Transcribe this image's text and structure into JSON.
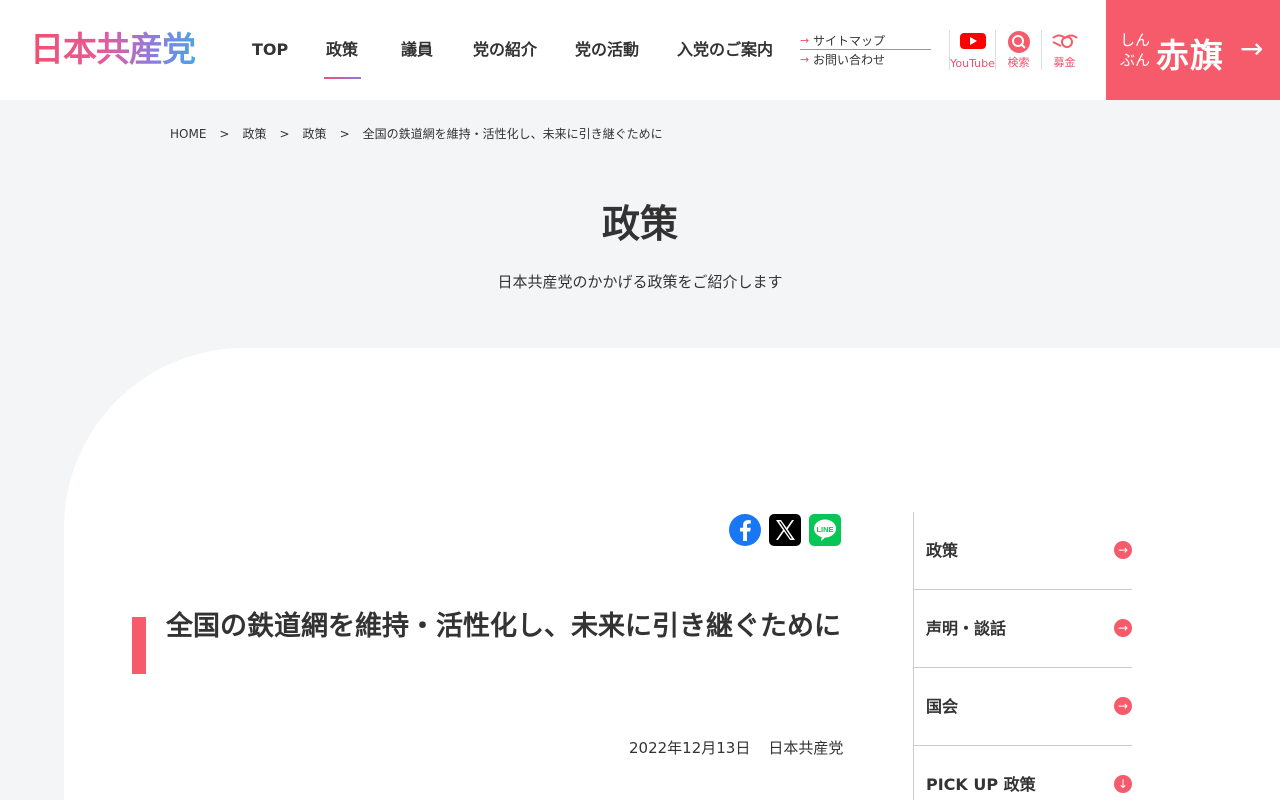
{
  "header": {
    "logo": "日本共産党",
    "nav": [
      "TOP",
      "政策",
      "議員",
      "党の紹介",
      "党の活動",
      "入党のご案内"
    ],
    "active_nav": "政策",
    "sublinks": [
      "サイトマップ",
      "お問い合わせ"
    ],
    "icons": [
      {
        "label": "YouTube",
        "icon": "youtube-icon"
      },
      {
        "label": "検索",
        "icon": "search-icon"
      },
      {
        "label": "募金",
        "icon": "donation-icon"
      }
    ],
    "akahata": {
      "small": "しんぶん",
      "big": "赤旗",
      "arrow": "→"
    }
  },
  "breadcrumb": [
    "HOME",
    "政策",
    "政策",
    "全国の鉄道網を維持・活性化し、未来に引き継ぐために"
  ],
  "breadcrumb_sep": ">",
  "hero": {
    "title": "政策",
    "subtitle": "日本共産党のかかげる政策をご紹介します"
  },
  "share": [
    "facebook-icon",
    "x-icon",
    "line-icon"
  ],
  "article": {
    "title": "全国の鉄道網を維持・活性化し、未来に引き継ぐために",
    "date": "2022年12月13日",
    "author": "日本共産党"
  },
  "sidebar": [
    {
      "label": "政策",
      "arrow": "→"
    },
    {
      "label": "声明・談話",
      "arrow": "→"
    },
    {
      "label": "国会",
      "arrow": "→"
    },
    {
      "label": "PICK UP 政策",
      "arrow": "↓"
    }
  ],
  "colors": {
    "accent": "#f55b6a",
    "bg": "#f4f5f7"
  }
}
